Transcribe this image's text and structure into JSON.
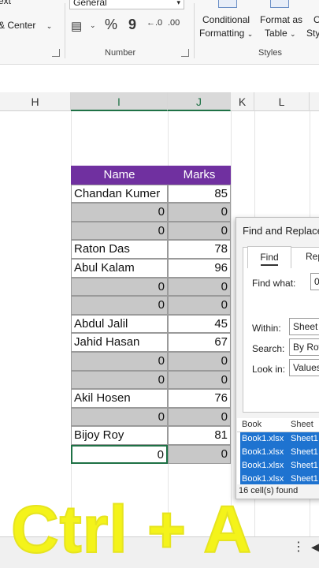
{
  "ribbon": {
    "partial_text_top": "ext",
    "merge_center": "& Center",
    "number_format_value": "General",
    "number_group_label": "Number",
    "conditional_formatting_line1": "Conditional",
    "conditional_formatting_line2": "Formatting",
    "format_as_table_line1": "Format as",
    "format_as_table_line2": "Table",
    "cell_styles_line1": "C",
    "cell_styles_line2": "Sty",
    "styles_group_label": "Styles",
    "percent_symbol": "%",
    "comma_symbol": "9"
  },
  "columns": [
    "H",
    "I",
    "J",
    "K",
    "L"
  ],
  "table": {
    "header": {
      "name": "Name",
      "marks": "Marks"
    },
    "rows": [
      {
        "name": "Chandan Kumer",
        "marks": "85",
        "gray": false
      },
      {
        "name": "0",
        "marks": "0",
        "gray": true
      },
      {
        "name": "0",
        "marks": "0",
        "gray": true
      },
      {
        "name": "Raton Das",
        "marks": "78",
        "gray": false
      },
      {
        "name": "Abul Kalam",
        "marks": "96",
        "gray": false
      },
      {
        "name": "0",
        "marks": "0",
        "gray": true
      },
      {
        "name": "0",
        "marks": "0",
        "gray": true
      },
      {
        "name": "Abdul Jalil",
        "marks": "45",
        "gray": false
      },
      {
        "name": "Jahid Hasan",
        "marks": "67",
        "gray": false
      },
      {
        "name": "0",
        "marks": "0",
        "gray": true
      },
      {
        "name": "0",
        "marks": "0",
        "gray": true
      },
      {
        "name": "Akil Hosen",
        "marks": "76",
        "gray": false
      },
      {
        "name": "0",
        "marks": "0",
        "gray": true
      },
      {
        "name": "Bijoy Roy",
        "marks": "81",
        "gray": false
      },
      {
        "name": "0",
        "marks": "0",
        "gray": true,
        "active": true
      }
    ]
  },
  "dialog": {
    "title": "Find and Replace",
    "tab_find": "Find",
    "tab_replace": "Rep",
    "find_what_label": "Find what:",
    "find_what_value": "0",
    "within_label": "Within:",
    "within_value": "Sheet",
    "search_label": "Search:",
    "search_value": "By Row",
    "look_in_label": "Look in:",
    "look_in_value": "Values",
    "results_headers": {
      "book": "Book",
      "sheet": "Sheet"
    },
    "results": [
      {
        "book": "Book1.xlsx",
        "sheet": "Sheet1"
      },
      {
        "book": "Book1.xlsx",
        "sheet": "Sheet1"
      },
      {
        "book": "Book1.xlsx",
        "sheet": "Sheet1"
      },
      {
        "book": "Book1.xlsx",
        "sheet": "Sheet1"
      }
    ],
    "status": "16 cell(s) found"
  },
  "overlay_text": "Ctrl + A",
  "colors": {
    "header_purple": "#7030a0",
    "selection_gray": "#c8c8c8",
    "excel_green": "#1e7145",
    "result_blue": "#1e73d0",
    "overlay_yellow": "#f4f31a"
  }
}
